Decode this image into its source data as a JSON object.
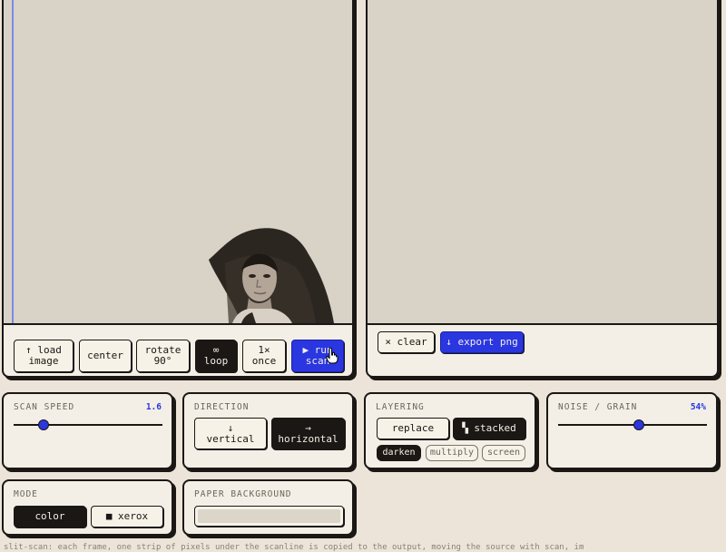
{
  "scan_panel": {
    "buttons": {
      "load": "↑ load\nimage",
      "center": "center",
      "rotate": "rotate\n90°",
      "loop": "∞\nloop",
      "once": "1×\nonce",
      "run": "▶ run\nscan"
    },
    "active_mode": "loop"
  },
  "output_panel": {
    "buttons": {
      "clear": "× clear",
      "export": "↓ export png"
    }
  },
  "scan_speed": {
    "label": "SCAN SPEED",
    "value": "1.6",
    "level": 0.2
  },
  "direction": {
    "label": "DIRECTION",
    "options": [
      "↓\nvertical",
      "→\nhorizontal"
    ],
    "selected": "horizontal"
  },
  "layering": {
    "label": "LAYERING",
    "options": [
      "replace",
      "▚ stacked"
    ],
    "selected": "stacked",
    "blend_modes": [
      "darken",
      "multiply",
      "screen"
    ],
    "blend_selected": "darken"
  },
  "noise": {
    "label": "NOISE / GRAIN",
    "value": "54%",
    "level": 0.54
  },
  "mode": {
    "label": "MODE",
    "options": [
      "color",
      "■ xerox"
    ],
    "selected": "color"
  },
  "paper": {
    "label": "PAPER BACKGROUND",
    "swatch": "#dcd5ca"
  },
  "footer_text": "slit-scan: each frame, one strip of pixels under the scanline is copied to the output, moving the source with scan, images",
  "colors": {
    "accent": "#2a36e0",
    "ink": "#1a1714",
    "paper": "#f3efe6"
  }
}
